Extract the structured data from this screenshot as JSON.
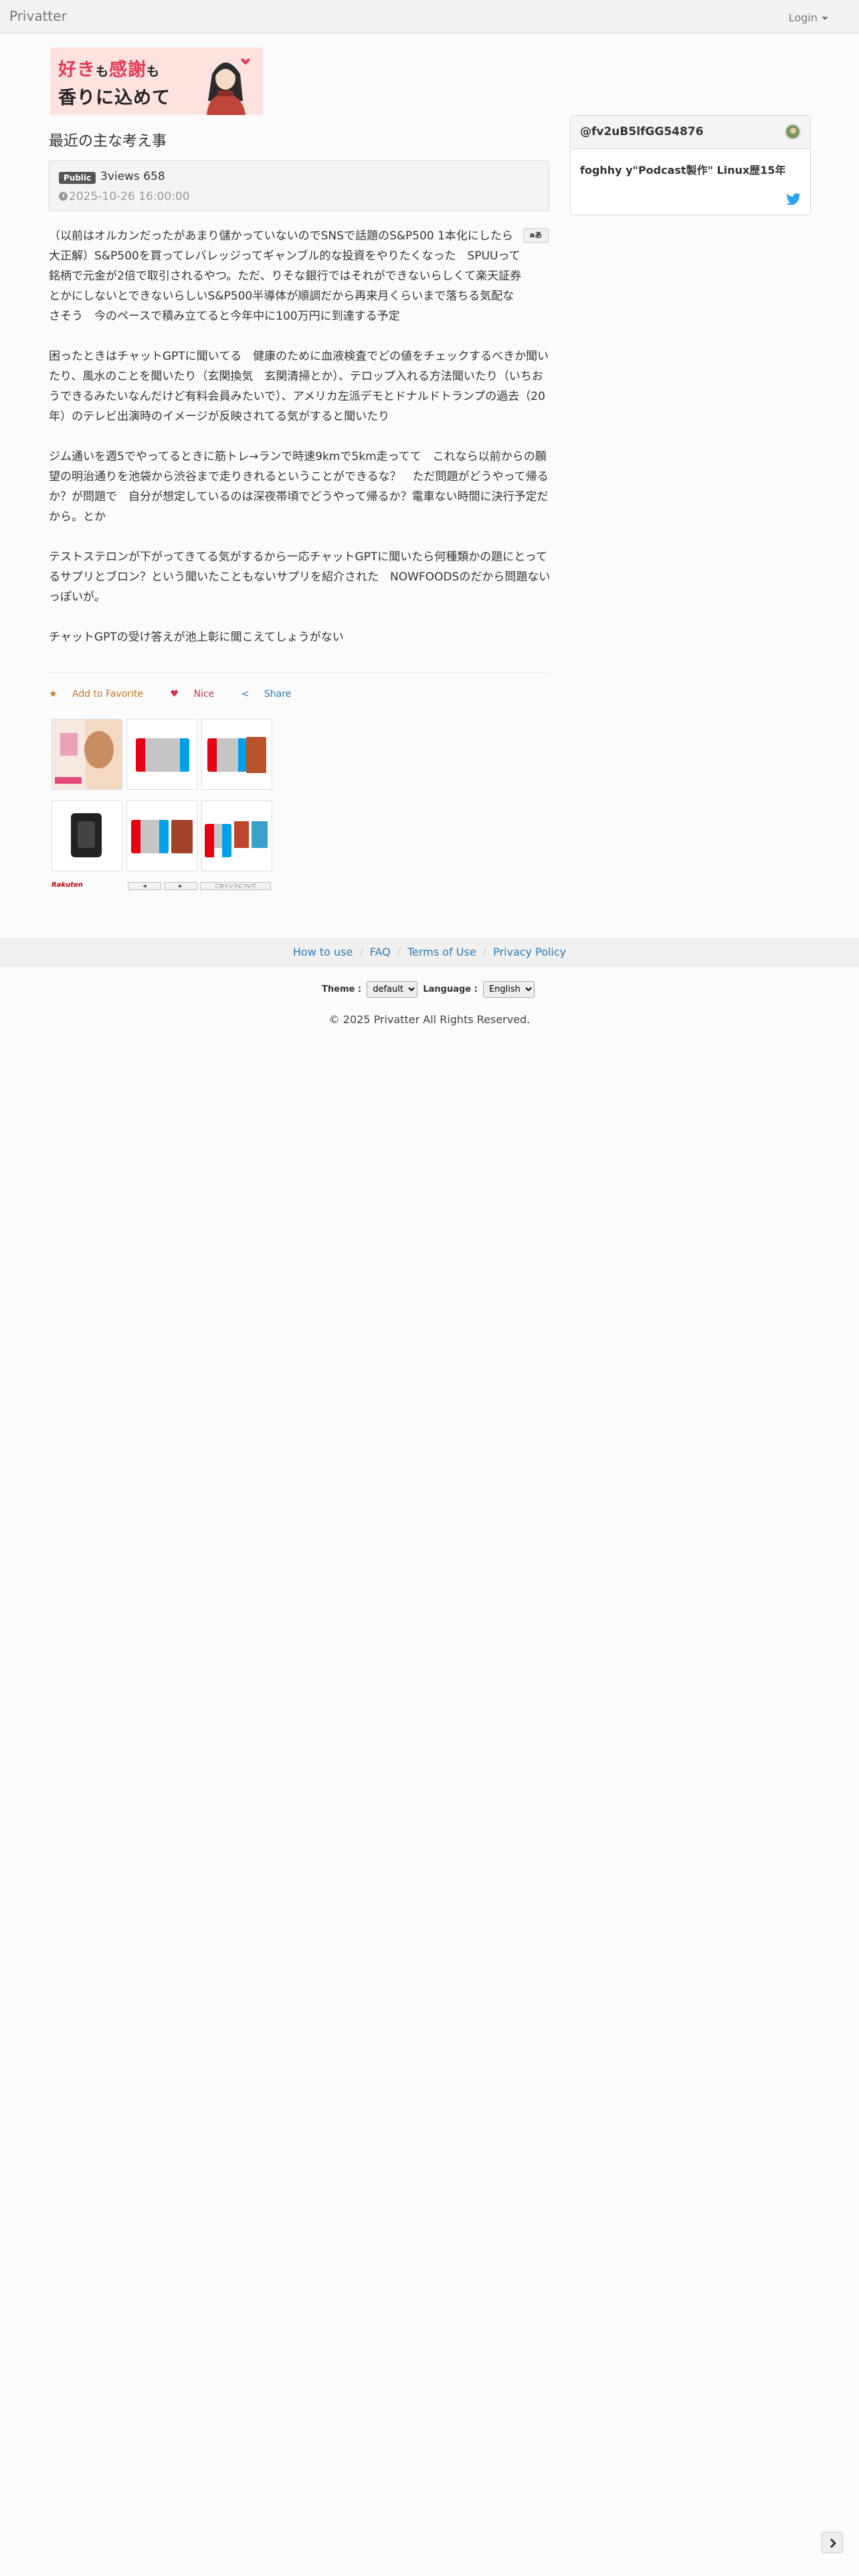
{
  "navbar": {
    "brand": "Privatter",
    "login": "Login"
  },
  "banner": {
    "line1_a": "好き",
    "line1_b": "も",
    "line1_c": "感謝",
    "line1_d": "も",
    "line2": "香りに込めて"
  },
  "post": {
    "title": "最近の主な考え事",
    "visibility": "Public",
    "views": "3views 658",
    "date": "2025-10-26 16:00:00",
    "text_size_button": "aあ",
    "paragraphs": [
      "（以前はオルカンだったがあまり儲かっていないのでSNSで話題のS&P500 1本化にしたら大正解）S&P500を買ってレバレッジってギャンブル的な投資をやりたくなった　SPUUって銘柄で元金が2倍で取引されるやつ。ただ、りそな銀行ではそれができないらしくて楽天証券とかにしないとできないらしいS&P500半導体が順調だから再来月くらいまで落ちる気配なさそう　今のペースで積み立てると今年中に100万円に到達する予定",
      "困ったときはチャットGPTに聞いてる　健康のために血液検査でどの値をチェックするべきか聞いたり、風水のことを聞いたり（玄関換気　玄関清掃とか）、テロップ入れる方法聞いたり（いちおうできるみたいなんだけど有料会員みたいで）、アメリカ左派デモとドナルドトランプの過去（20年）のテレビ出演時のイメージが反映されてる気がすると聞いたり",
      "ジム通いを週5でやってるときに筋トレ→ランで時速9kmで5km走ってて　これなら以前からの願望の明治通りを池袋から渋谷まで走りきれるということができるな？　ただ問題がどうやって帰るか？が問題で　自分が想定しているのは深夜帯頃でどうやって帰るか？電車ない時間に決行予定だから。とか",
      "テストステロンが下がってきてる気がするから一応チャットGPTに聞いたら何種類かの題にとってるサプリとブロン？という聞いたこともないサプリを紹介された　NOWFOODSのだから問題ないっぽいが。",
      "チャットGPTの受け答えが池上彰に聞こえてしょうがない"
    ],
    "actions": {
      "favorite": "Add to Favorite",
      "nice": "Nice",
      "share": "Share"
    }
  },
  "ads": {
    "rakuten": "Rakuten",
    "btn1": "◀",
    "btn2": "▶",
    "btn3": "このリンクについて"
  },
  "user": {
    "handle": "@fv2uB5lfGG54876",
    "description": "foghhy y\"Podcast製作\" Linux歴15年"
  },
  "footer": {
    "links": [
      "How to use",
      "FAQ",
      "Terms of Use",
      "Privacy Policy"
    ],
    "theme_label": "Theme :",
    "theme_value": "default",
    "language_label": "Language :",
    "language_value": "English",
    "copyright": "© 2025 Privatter All Rights Reserved."
  },
  "colors": {
    "link": "#2a7ab7",
    "favorite": "#c07b2b",
    "nice": "#cc3355",
    "banner_bg": "#fde3df"
  },
  "icons": [
    "caret-down-icon",
    "clock-icon",
    "star-icon",
    "heart-icon",
    "share-icon",
    "twitter-icon",
    "chevron-right-icon"
  ]
}
